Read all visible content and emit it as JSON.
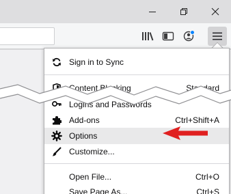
{
  "window": {
    "min_icon": "minimize-icon",
    "max_icon": "restore-icon",
    "close_icon": "close-icon"
  },
  "toolbar": {
    "icons": [
      "library-icon",
      "sidebar-icon",
      "account-icon",
      "hamburger-menu-icon"
    ],
    "account_badge_color": "#0a84ff"
  },
  "menu": {
    "items": [
      {
        "label": "Sign in to Sync",
        "shortcut": "",
        "icon": "sync-icon"
      },
      {
        "label": "Content Blocking",
        "shortcut": "Standard",
        "icon": "shield-icon"
      },
      {
        "label": "Logins and Passwords",
        "shortcut": "",
        "icon": "key-icon"
      },
      {
        "label": "Add-ons",
        "shortcut": "Ctrl+Shift+A",
        "icon": "puzzle-icon"
      },
      {
        "label": "Options",
        "shortcut": "",
        "icon": "gear-icon"
      },
      {
        "label": "Customize...",
        "shortcut": "",
        "icon": "brush-icon"
      },
      {
        "label": "Open File...",
        "shortcut": "Ctrl+O",
        "icon": ""
      },
      {
        "label": "Save Page As...",
        "shortcut": "Ctrl+S",
        "icon": ""
      }
    ]
  },
  "annotation": {
    "arrow_color": "#e02020"
  }
}
